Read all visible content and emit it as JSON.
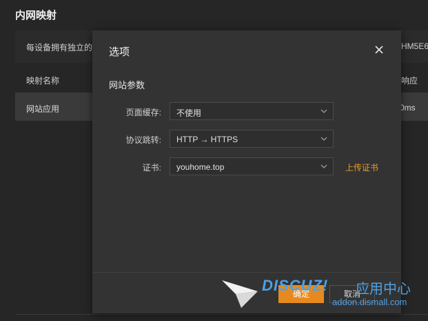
{
  "page": {
    "title": "内网映射",
    "description": "每设备拥有独立的",
    "device_code": "HM5E6",
    "table_header_name": "映射名称",
    "table_header_right": "响应",
    "row_name": "网站应用",
    "row_right": "0ms"
  },
  "modal": {
    "title": "选项",
    "section_title": "网站参数",
    "fields": [
      {
        "label": "页面缓存:",
        "value": "不使用"
      },
      {
        "label": "协议跳转:",
        "value": "HTTP → HTTPS"
      },
      {
        "label": "证书:",
        "value": "youhome.top"
      }
    ],
    "upload_link": "上传证书",
    "confirm_label": "确定",
    "cancel_label": "取消"
  },
  "watermark": {
    "logo": "DISCUZ!",
    "text": "应用中心",
    "url": "addon.dismall.com"
  },
  "colors": {
    "accent": "#e68a1f",
    "link": "#e79a2b",
    "watermark": "#4ea1e6"
  }
}
